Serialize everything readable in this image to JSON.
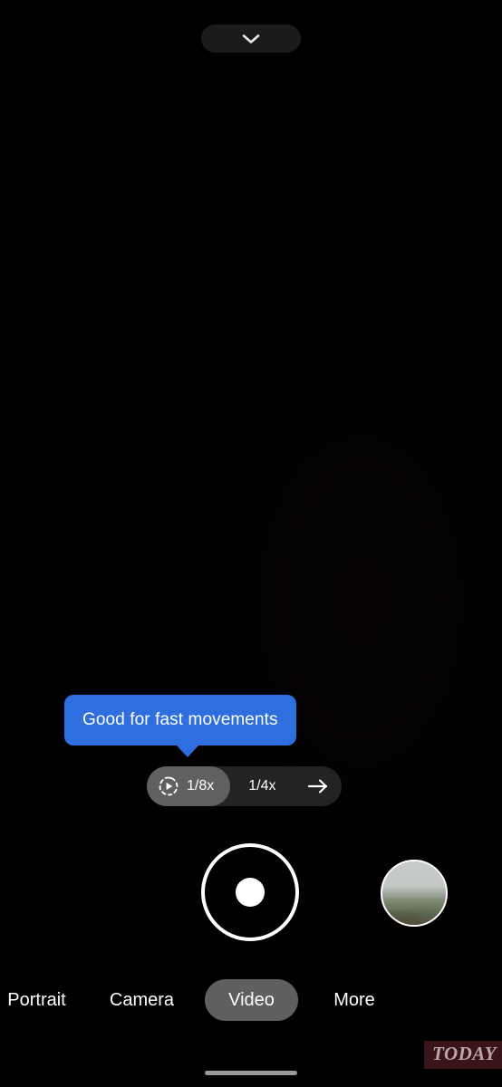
{
  "app": {
    "name": "Camera",
    "screen": "video-slow-motion"
  },
  "viewfinder": {
    "state": "black-preview",
    "background_color": "#000000"
  },
  "top_bar": {
    "expand_pill": {
      "icon": "chevron-down-icon",
      "label": "",
      "background_color": "#1b1b1b"
    }
  },
  "tooltip": {
    "text": "Good for fast movements",
    "background_color": "#2f6ede",
    "text_color": "#ffffff"
  },
  "speed_selector": {
    "background_color": "#232323",
    "selected_color": "#606060",
    "options": [
      {
        "label": "1/8x",
        "icon": "slow-motion-icon",
        "selected": true
      },
      {
        "label": "1/4x",
        "icon": "",
        "selected": false
      }
    ],
    "next_icon": "arrow-right-icon"
  },
  "capture": {
    "shutter": {
      "icon": "record-button",
      "ring_color": "#ffffff",
      "dot_color": "#ffffff"
    },
    "thumbnail": {
      "icon": "gallery-thumbnail",
      "description": "landscape photo"
    }
  },
  "modes": {
    "items": [
      {
        "label": "Portrait",
        "selected": false
      },
      {
        "label": "Camera",
        "selected": false
      },
      {
        "label": "Video",
        "selected": true
      },
      {
        "label": "More",
        "selected": false
      }
    ],
    "selected_background": "#5f5f5f"
  },
  "watermark": {
    "text": "TODAY",
    "background_color": "#3a1418",
    "text_color": "#b9a8a4"
  },
  "system": {
    "home_indicator_color": "#9a9a9a"
  }
}
